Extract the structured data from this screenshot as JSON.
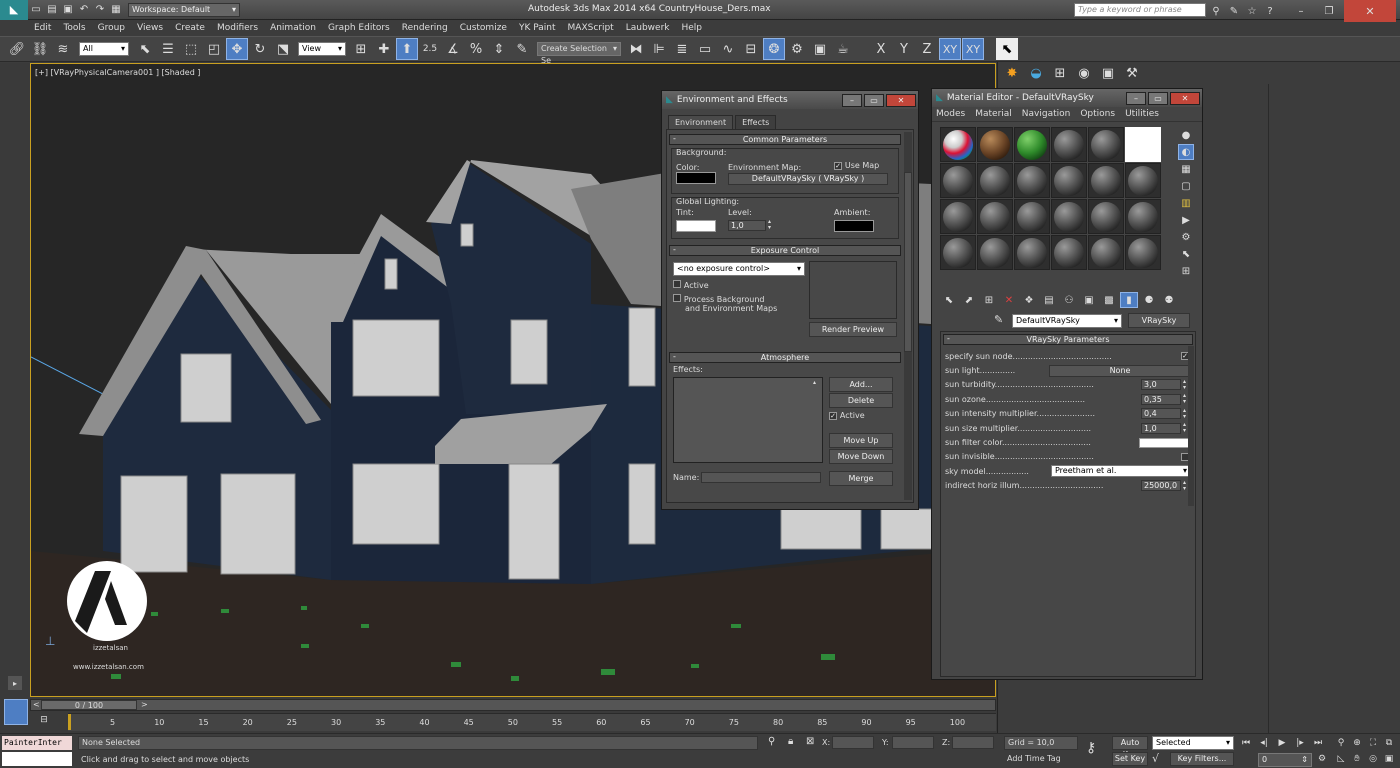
{
  "app": {
    "title": "Autodesk 3ds Max  2014 x64      CountryHouse_Ders.max",
    "workspace": "Workspace: Default",
    "search_placeholder": "Type a keyword or phrase"
  },
  "menu": [
    "Edit",
    "Tools",
    "Group",
    "Views",
    "Create",
    "Modifiers",
    "Animation",
    "Graph Editors",
    "Rendering",
    "Customize",
    "YK Paint",
    "MAXScript",
    "Laubwerk",
    "Help"
  ],
  "toolbar": {
    "filter": "All",
    "refcoord": "View",
    "selection_set": "Create Selection Se",
    "snap_angle": "2.5",
    "axes": [
      "X",
      "Y",
      "Z",
      "XY",
      "XY"
    ]
  },
  "viewport": {
    "label": "[+] [VRayPhysicalCamera001 ] [Shaded ]",
    "logo_text": "izzetalsan",
    "logo_url": "www.izzetalsan.com"
  },
  "env": {
    "title": "Environment and Effects",
    "tabs": [
      "Environment",
      "Effects"
    ],
    "common": "Common Parameters",
    "background": "Background:",
    "color": "Color:",
    "env_map": "Environment Map:",
    "use_map": "Use Map",
    "map_name": "DefaultVRaySky  ( VRaySky )",
    "global_lighting": "Global Lighting:",
    "tint": "Tint:",
    "level": "Level:",
    "level_value": "1,0",
    "ambient": "Ambient:",
    "exposure": "Exposure Control",
    "exposure_value": "<no exposure control>",
    "active": "Active",
    "process_bg": "Process Background",
    "process_bg2": "and Environment Maps",
    "render_preview": "Render Preview",
    "atmosphere": "Atmosphere",
    "effects": "Effects:",
    "add": "Add...",
    "delete": "Delete",
    "atm_active": "Active",
    "move_up": "Move Up",
    "move_down": "Move Down",
    "name": "Name:",
    "merge": "Merge"
  },
  "mat": {
    "title": "Material Editor - DefaultVRaySky",
    "menu": [
      "Modes",
      "Material",
      "Navigation",
      "Options",
      "Utilities"
    ],
    "material_name": "DefaultVRaySky",
    "material_type": "VRaySky",
    "rollout": "VRaySky Parameters",
    "params": [
      {
        "name": "specify sun node.......................................",
        "kind": "check",
        "value": "✓"
      },
      {
        "name": "sun light..............",
        "kind": "button",
        "value": "None"
      },
      {
        "name": "sun turbidity.......................................",
        "kind": "spin",
        "value": "3,0"
      },
      {
        "name": "sun ozone.......................................",
        "kind": "spin",
        "value": "0,35"
      },
      {
        "name": "sun intensity multiplier.......................",
        "kind": "spin",
        "value": "0,4"
      },
      {
        "name": "sun size multiplier.............................",
        "kind": "spin",
        "value": "1,0"
      },
      {
        "name": "sun filter color...................................",
        "kind": "color",
        "value": ""
      },
      {
        "name": "sun invisible.......................................",
        "kind": "check",
        "value": ""
      },
      {
        "name": "sky model.................",
        "kind": "dropdown",
        "value": "Preetham et al."
      },
      {
        "name": "indirect horiz illum.................................",
        "kind": "spin",
        "value": "25000,0"
      }
    ]
  },
  "timeline": {
    "range": "0 / 100",
    "ticks": [
      "5",
      "10",
      "15",
      "20",
      "25",
      "30",
      "35",
      "40",
      "45",
      "50",
      "55",
      "60",
      "65",
      "70",
      "75",
      "80",
      "85",
      "90",
      "95",
      "100"
    ]
  },
  "status": {
    "script": "PainterInter",
    "selected": "None Selected",
    "prompt": "Click and drag to select and move objects",
    "x": "X:",
    "y": "Y:",
    "z": "Z:",
    "grid": "Grid = 10,0",
    "add_time_tag": "Add Time Tag",
    "auto_key": "Auto Key",
    "set_key": "Set Key",
    "selected_mode": "Selected",
    "key_filters": "Key Filters...",
    "frame": "0"
  },
  "colors": {
    "house": "#1e2a3e",
    "roof": "#8a8a8a",
    "ground": "#2e2622",
    "accent": "#4e7ec3"
  }
}
